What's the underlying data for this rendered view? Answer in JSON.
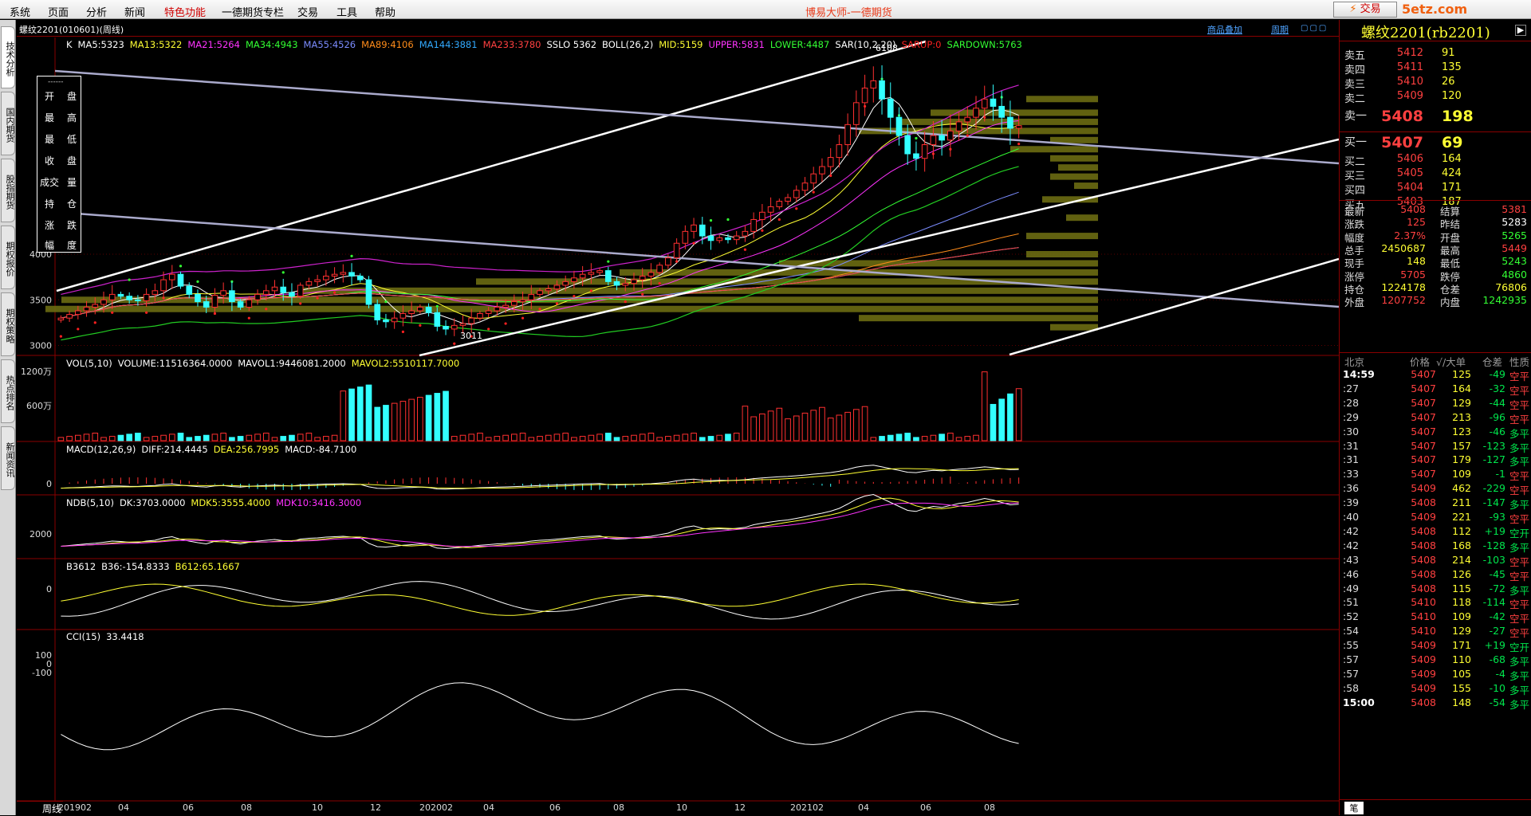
{
  "menu": {
    "items": [
      "系统",
      "页面",
      "分析",
      "新闻",
      "特色功能",
      "一德期货专栏",
      "交易",
      "工具",
      "帮助"
    ],
    "special_index": 4,
    "app_title": "博易大师-一德期货",
    "trade_button": "交易",
    "watermark": "5etz.com"
  },
  "left_tabs": [
    "技术分析",
    "国内期货",
    "股指期货",
    "期权报价",
    "期权策略",
    "热点排名",
    "新闻资讯"
  ],
  "chart": {
    "contract_label": "螺纹2201(010601)(周线)",
    "overlay_link": "商品叠加",
    "period_link": "周期",
    "window_controls": "▢▢▢",
    "main_indicators": [
      {
        "text": "K",
        "color": "#ffffff"
      },
      {
        "text": "MA5:5323",
        "color": "#ffffff"
      },
      {
        "text": "MA13:5322",
        "color": "#ffff33"
      },
      {
        "text": "MA21:5264",
        "color": "#ff33ff"
      },
      {
        "text": "MA34:4943",
        "color": "#33ff33"
      },
      {
        "text": "MA55:4526",
        "color": "#7b8cff"
      },
      {
        "text": "MA89:4106",
        "color": "#ff8c1a"
      },
      {
        "text": "MA144:3881",
        "color": "#33aaff"
      },
      {
        "text": "MA233:3780",
        "color": "#ff4040"
      },
      {
        "text": "SSLO 5362",
        "color": "#ffffff"
      },
      {
        "text": "BOLL(26,2)",
        "color": "#ffffff"
      },
      {
        "text": "MID:5159",
        "color": "#ffff33"
      },
      {
        "text": "UPPER:5831",
        "color": "#ff33ff"
      },
      {
        "text": "LOWER:4487",
        "color": "#33ff33"
      },
      {
        "text": "SAR(10,2,20)",
        "color": "#ffffff"
      },
      {
        "text": "SARUP:0",
        "color": "#ff2020"
      },
      {
        "text": "SARDOWN:5763",
        "color": "#33ff33"
      }
    ],
    "price_axis": [
      "4000",
      "3500",
      "3000"
    ],
    "high_mark": "6108",
    "low_mark": "3011",
    "vol_indicators": [
      {
        "text": "VOL(5,10)",
        "color": "#ffffff"
      },
      {
        "text": "VOLUME:11516364.0000",
        "color": "#ffffff"
      },
      {
        "text": "MAVOL1:9446081.2000",
        "color": "#ffffff"
      },
      {
        "text": "MAVOL2:5510117.7000",
        "color": "#ffff33"
      }
    ],
    "vol_axis": [
      "1200万",
      "600万"
    ],
    "macd_indicators": [
      {
        "text": "MACD(12,26,9)",
        "color": "#ffffff"
      },
      {
        "text": "DIFF:214.4445",
        "color": "#ffffff"
      },
      {
        "text": "DEA:256.7995",
        "color": "#ffff33"
      },
      {
        "text": "MACD:-84.7100",
        "color": "#ffffff"
      }
    ],
    "macd_axis": [
      "0"
    ],
    "ndb_indicators": [
      {
        "text": "NDB(5,10)",
        "color": "#ffffff"
      },
      {
        "text": "DK:3703.0000",
        "color": "#ffffff"
      },
      {
        "text": "MDK5:3555.4000",
        "color": "#ffff33"
      },
      {
        "text": "MDK10:3416.3000",
        "color": "#ff33ff"
      }
    ],
    "ndb_axis": [
      "2000"
    ],
    "b36_indicators": [
      {
        "text": "B3612",
        "color": "#ffffff"
      },
      {
        "text": "B36:-154.8333",
        "color": "#ffffff"
      },
      {
        "text": "B612:65.1667",
        "color": "#ffff33"
      }
    ],
    "b36_axis": [
      "0"
    ],
    "cci_indicators": [
      {
        "text": "CCI(15)",
        "color": "#ffffff"
      },
      {
        "text": "33.4418",
        "color": "#ffffff"
      }
    ],
    "cci_axis": [
      "100",
      "0",
      "-100"
    ],
    "period_tag": "周线",
    "x_ticks": [
      "201902",
      "04",
      "06",
      "08",
      "10",
      "12",
      "202002",
      "04",
      "06",
      "08",
      "10",
      "12",
      "202102",
      "04",
      "06",
      "08"
    ]
  },
  "ohlc_panel": {
    "dash": "------",
    "rows": [
      [
        "开",
        "盘"
      ],
      [
        "最",
        "高"
      ],
      [
        "最",
        "低"
      ],
      [
        "收",
        "盘"
      ],
      [
        "成交",
        "量"
      ],
      [
        "持",
        "仓"
      ],
      [
        "涨",
        "跌"
      ],
      [
        "幅",
        "度"
      ]
    ]
  },
  "quote": {
    "title": "螺纹2201(rb2201)",
    "asks": [
      {
        "label": "卖五",
        "price": "5412",
        "qty": "91"
      },
      {
        "label": "卖四",
        "price": "5411",
        "qty": "135"
      },
      {
        "label": "卖三",
        "price": "5410",
        "qty": "26"
      },
      {
        "label": "卖二",
        "price": "5409",
        "qty": "120"
      },
      {
        "label": "卖一",
        "price": "5408",
        "qty": "198"
      }
    ],
    "bids": [
      {
        "label": "买一",
        "price": "5407",
        "qty": "69"
      },
      {
        "label": "买二",
        "price": "5406",
        "qty": "164"
      },
      {
        "label": "买三",
        "price": "5405",
        "qty": "424"
      },
      {
        "label": "买四",
        "price": "5404",
        "qty": "171"
      },
      {
        "label": "买五",
        "price": "5403",
        "qty": "187"
      }
    ],
    "stats": [
      {
        "l1": "最新",
        "v1": "5408",
        "c1": "#ff4040",
        "l2": "结算",
        "v2": "5381",
        "c2": "#ff4040"
      },
      {
        "l1": "涨跌",
        "v1": "125",
        "c1": "#ff4040",
        "l2": "昨结",
        "v2": "5283",
        "c2": "#ffffff"
      },
      {
        "l1": "幅度",
        "v1": "2.37%",
        "c1": "#ff4040",
        "l2": "开盘",
        "v2": "5265",
        "c2": "#33ff33"
      },
      {
        "l1": "总手",
        "v1": "2450687",
        "c1": "#ffff33",
        "l2": "最高",
        "v2": "5449",
        "c2": "#ff4040"
      },
      {
        "l1": "现手",
        "v1": "148",
        "c1": "#ffff33",
        "l2": "最低",
        "v2": "5243",
        "c2": "#33ff33"
      },
      {
        "l1": "涨停",
        "v1": "5705",
        "c1": "#ff4040",
        "l2": "跌停",
        "v2": "4860",
        "c2": "#33ff33"
      },
      {
        "l1": "持仓",
        "v1": "1224178",
        "c1": "#ffff33",
        "l2": "仓差",
        "v2": "76806",
        "c2": "#ffff33"
      },
      {
        "l1": "外盘",
        "v1": "1207752",
        "c1": "#ff4040",
        "l2": "内盘",
        "v2": "1242935",
        "c2": "#33ff33"
      }
    ],
    "ticks_header": {
      "loc": "北京",
      "price": "价格",
      "vol": "√/大单",
      "oi": "仓差",
      "nature": "性质"
    },
    "ticks": [
      {
        "t": "14:59",
        "p": "5407",
        "v": "125",
        "d": "-49",
        "n": "空平",
        "full": true
      },
      {
        "t": ":27",
        "p": "5407",
        "v": "164",
        "d": "-32",
        "n": "空平"
      },
      {
        "t": ":28",
        "p": "5407",
        "v": "129",
        "d": "-44",
        "n": "空平"
      },
      {
        "t": ":29",
        "p": "5407",
        "v": "213",
        "d": "-96",
        "n": "空平"
      },
      {
        "t": ":30",
        "p": "5407",
        "v": "123",
        "d": "-46",
        "n": "多平"
      },
      {
        "t": ":31",
        "p": "5407",
        "v": "157",
        "d": "-123",
        "n": "多平"
      },
      {
        "t": ":31",
        "p": "5407",
        "v": "179",
        "d": "-127",
        "n": "多平"
      },
      {
        "t": ":33",
        "p": "5407",
        "v": "109",
        "d": "-1",
        "n": "空平"
      },
      {
        "t": ":36",
        "p": "5409",
        "v": "462",
        "d": "-229",
        "n": "空平"
      },
      {
        "t": ":39",
        "p": "5408",
        "v": "211",
        "d": "-147",
        "n": "多平"
      },
      {
        "t": ":40",
        "p": "5409",
        "v": "221",
        "d": "-93",
        "n": "空平"
      },
      {
        "t": ":42",
        "p": "5408",
        "v": "112",
        "d": "+19",
        "n": "空开"
      },
      {
        "t": ":42",
        "p": "5408",
        "v": "168",
        "d": "-128",
        "n": "多平"
      },
      {
        "t": ":43",
        "p": "5408",
        "v": "214",
        "d": "-103",
        "n": "空平"
      },
      {
        "t": ":46",
        "p": "5408",
        "v": "126",
        "d": "-45",
        "n": "空平"
      },
      {
        "t": ":49",
        "p": "5408",
        "v": "115",
        "d": "-72",
        "n": "多平"
      },
      {
        "t": ":51",
        "p": "5410",
        "v": "118",
        "d": "-114",
        "n": "空平"
      },
      {
        "t": ":52",
        "p": "5410",
        "v": "109",
        "d": "-42",
        "n": "空平"
      },
      {
        "t": ":54",
        "p": "5410",
        "v": "129",
        "d": "-27",
        "n": "空平"
      },
      {
        "t": ":55",
        "p": "5409",
        "v": "171",
        "d": "+19",
        "n": "空开"
      },
      {
        "t": ":57",
        "p": "5409",
        "v": "110",
        "d": "-68",
        "n": "多平"
      },
      {
        "t": ":57",
        "p": "5409",
        "v": "105",
        "d": "-4",
        "n": "多平"
      },
      {
        "t": ":58",
        "p": "5409",
        "v": "155",
        "d": "-10",
        "n": "多平"
      },
      {
        "t": "15:00",
        "p": "5408",
        "v": "148",
        "d": "-54",
        "n": "多平",
        "full": true
      }
    ],
    "footer_tab": "笔"
  },
  "chart_data": {
    "type": "candlestick",
    "title": "螺纹2201(010601)(周线)",
    "x_ticks": [
      "201902",
      "04",
      "06",
      "08",
      "10",
      "12",
      "202002",
      "04",
      "06",
      "08",
      "10",
      "12",
      "202102",
      "04",
      "06",
      "08"
    ],
    "ylim": [
      2900,
      6200
    ],
    "annotations": [
      {
        "text": "6108",
        "value": 6108
      },
      {
        "text": "3011",
        "value": 3011
      }
    ],
    "close_series": [
      3300,
      3340,
      3380,
      3420,
      3450,
      3500,
      3560,
      3540,
      3500,
      3490,
      3560,
      3600,
      3720,
      3780,
      3650,
      3560,
      3480,
      3420,
      3550,
      3600,
      3480,
      3420,
      3500,
      3560,
      3600,
      3640,
      3580,
      3540,
      3660,
      3700,
      3720,
      3760,
      3780,
      3800,
      3760,
      3720,
      3450,
      3280,
      3260,
      3300,
      3350,
      3380,
      3420,
      3360,
      3210,
      3180,
      3220,
      3240,
      3300,
      3350,
      3380,
      3420,
      3440,
      3480,
      3500,
      3560,
      3600,
      3620,
      3660,
      3700,
      3740,
      3780,
      3800,
      3820,
      3700,
      3660,
      3680,
      3720,
      3760,
      3800,
      3880,
      3960,
      4120,
      4250,
      4320,
      4200,
      4150,
      4180,
      4160,
      4200,
      4250,
      4380,
      4460,
      4520,
      4580,
      4620,
      4700,
      4780,
      4880,
      4960,
      5060,
      5200,
      5420,
      5660,
      5820,
      5900,
      5700,
      5500,
      5300,
      5100,
      5050,
      5200,
      5300,
      5250,
      5350,
      5450,
      5500,
      5600,
      5700,
      5620,
      5500,
      5380,
      5408
    ],
    "series": [
      {
        "name": "MA5",
        "value": 5323
      },
      {
        "name": "MA13",
        "value": 5322
      },
      {
        "name": "MA21",
        "value": 5264
      },
      {
        "name": "MA34",
        "value": 4943
      },
      {
        "name": "MA55",
        "value": 4526
      },
      {
        "name": "MA89",
        "value": 4106
      },
      {
        "name": "MA144",
        "value": 3881
      },
      {
        "name": "MA233",
        "value": 3780
      }
    ]
  }
}
